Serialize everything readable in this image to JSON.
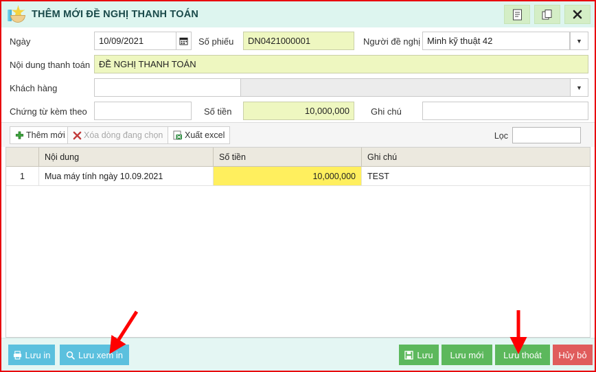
{
  "window": {
    "title": "THÊM MỚI ĐỀ NGHỊ THANH TOÁN",
    "icon": "star-in-hand-icon",
    "buttons": [
      {
        "name": "document-button",
        "icon": "document-icon"
      },
      {
        "name": "copy-button",
        "icon": "copy-icon"
      },
      {
        "name": "close-button",
        "icon": "close-icon"
      }
    ]
  },
  "form": {
    "date": {
      "label": "Ngày",
      "value": "10/09/2021",
      "icon": "calendar-icon"
    },
    "voucher": {
      "label": "Số phiếu",
      "value": "DN0421000001"
    },
    "requester": {
      "label": "Người đề nghị",
      "value": "Minh kỹ thuật 42",
      "icon": "chevron-down-icon"
    },
    "content": {
      "label": "Nội dung thanh toán",
      "value": "ĐỀ NGHỊ THANH TOÁN"
    },
    "customer": {
      "label": "Khách hàng",
      "value": "",
      "icon": "chevron-down-icon"
    },
    "attachment": {
      "label": "Chứng từ kèm theo",
      "value": ""
    },
    "amount": {
      "label": "Số tiền",
      "value": "10,000,000"
    },
    "note": {
      "label": "Ghi chú",
      "value": ""
    }
  },
  "grid_toolbar": {
    "add": {
      "label": "Thêm mới",
      "icon": "plus-icon"
    },
    "delete": {
      "label": "Xóa dòng đang chọn",
      "icon": "x-mark-icon"
    },
    "export": {
      "label": "Xuất excel",
      "icon": "excel-icon"
    },
    "filter": {
      "label": "Lọc",
      "value": ""
    }
  },
  "grid": {
    "columns": [
      "",
      "Nội dung",
      "Số tiền",
      "Ghi chú"
    ],
    "rows": [
      {
        "idx": "1",
        "noi_dung": "Mua máy tính ngày 10.09.2021",
        "so_tien": "10,000,000",
        "ghi_chu": "TEST"
      }
    ]
  },
  "footer": {
    "left": [
      {
        "label": "Lưu in",
        "icon": "printer-icon",
        "color": "#5bc0de"
      },
      {
        "label": "Lưu xem in",
        "icon": "search-icon",
        "color": "#5bc0de"
      }
    ],
    "right": [
      {
        "label": "Lưu",
        "icon": "save-icon",
        "color": "#5cb85c"
      },
      {
        "label": "Lưu mới",
        "icon": "",
        "color": "#5cb85c"
      },
      {
        "label": "Lưu thoát",
        "icon": "",
        "color": "#5cb85c"
      },
      {
        "label": "Hủy bỏ",
        "icon": "",
        "color": "#e05c5c"
      }
    ]
  },
  "annotations": {
    "color": "#ff0000",
    "arrows": [
      {
        "name": "arrow-to-luu-xem-in",
        "target": "Lưu xem in"
      },
      {
        "name": "arrow-to-luu-thoat",
        "target": "Lưu thoát"
      }
    ]
  }
}
